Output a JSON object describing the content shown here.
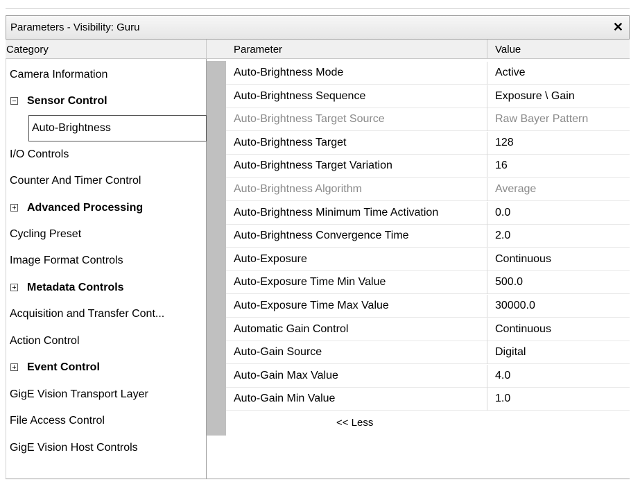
{
  "window": {
    "title": "Parameters - Visibility: Guru",
    "close_symbol": "✕"
  },
  "headers": {
    "category": "Category",
    "parameter": "Parameter",
    "value": "Value"
  },
  "categories": [
    {
      "label": "Camera Information",
      "bold": false,
      "expander": ""
    },
    {
      "label": "Sensor Control",
      "bold": true,
      "expander": "−"
    },
    {
      "label": "Auto-Brightness",
      "bold": false,
      "expander": "",
      "selected": true
    },
    {
      "label": "I/O Controls",
      "bold": false,
      "expander": ""
    },
    {
      "label": "Counter And Timer Control",
      "bold": false,
      "expander": ""
    },
    {
      "label": "Advanced Processing",
      "bold": true,
      "expander": "+"
    },
    {
      "label": "Cycling Preset",
      "bold": false,
      "expander": ""
    },
    {
      "label": "Image Format Controls",
      "bold": false,
      "expander": ""
    },
    {
      "label": "Metadata Controls",
      "bold": true,
      "expander": "+"
    },
    {
      "label": "Acquisition and Transfer Cont...",
      "bold": false,
      "expander": ""
    },
    {
      "label": "Action Control",
      "bold": false,
      "expander": ""
    },
    {
      "label": "Event Control",
      "bold": true,
      "expander": "+"
    },
    {
      "label": "GigE Vision Transport Layer",
      "bold": false,
      "expander": ""
    },
    {
      "label": "File Access Control",
      "bold": false,
      "expander": ""
    },
    {
      "label": "GigE Vision Host Controls",
      "bold": false,
      "expander": ""
    }
  ],
  "parameters": [
    {
      "name": "Auto-Brightness Mode",
      "value": "Active",
      "readonly": false
    },
    {
      "name": "Auto-Brightness Sequence",
      "value": "Exposure \\ Gain",
      "readonly": false
    },
    {
      "name": "Auto-Brightness Target Source",
      "value": "Raw Bayer Pattern",
      "readonly": true
    },
    {
      "name": "Auto-Brightness Target",
      "value": "128",
      "readonly": false
    },
    {
      "name": "Auto-Brightness Target Variation",
      "value": "16",
      "readonly": false
    },
    {
      "name": "Auto-Brightness Algorithm",
      "value": "Average",
      "readonly": true
    },
    {
      "name": "Auto-Brightness Minimum Time Activation",
      "value": "0.0",
      "readonly": false
    },
    {
      "name": "Auto-Brightness Convergence Time",
      "value": "2.0",
      "readonly": false
    },
    {
      "name": "Auto-Exposure",
      "value": "Continuous",
      "readonly": false
    },
    {
      "name": "Auto-Exposure Time Min Value",
      "value": "500.0",
      "readonly": false
    },
    {
      "name": "Auto-Exposure Time Max Value",
      "value": "30000.0",
      "readonly": false
    },
    {
      "name": "Automatic Gain Control",
      "value": "Continuous",
      "readonly": false
    },
    {
      "name": "Auto-Gain Source",
      "value": "Digital",
      "readonly": false
    },
    {
      "name": "Auto-Gain Max Value",
      "value": "4.0",
      "readonly": false
    },
    {
      "name": "Auto-Gain Min Value",
      "value": "1.0",
      "readonly": false
    }
  ],
  "less_label": "<< Less"
}
